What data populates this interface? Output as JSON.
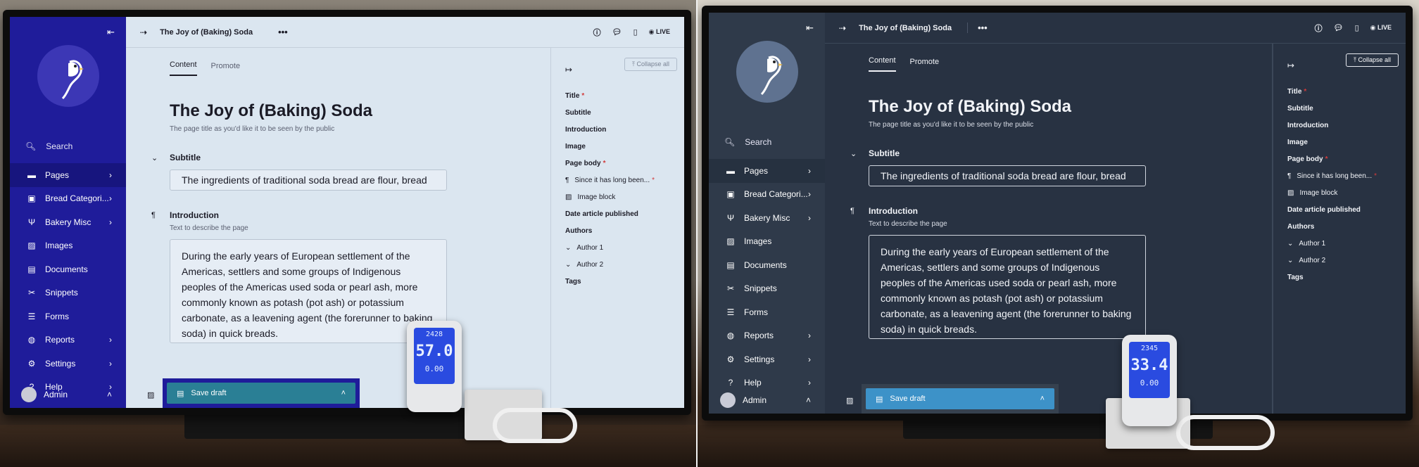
{
  "panels": [
    {
      "theme": "light",
      "topbar": {
        "title": "The Joy of (Baking) Soda",
        "live": "LIVE"
      },
      "meter": {
        "top": "2428",
        "mid": "57.0",
        "bot": "0.00"
      }
    },
    {
      "theme": "dark",
      "topbar": {
        "title": "The Joy of (Baking) Soda",
        "live": "LIVE"
      },
      "meter": {
        "top": "2345",
        "mid": "33.4",
        "bot": "0.00"
      }
    }
  ],
  "sidebar": {
    "search": "Search",
    "items": [
      {
        "label": "Pages",
        "icon": "folder-icon",
        "chevron": true
      },
      {
        "label": "Bread Categori...",
        "icon": "suitcase-icon",
        "chevron": true
      },
      {
        "label": "Bakery Misc",
        "icon": "utensils-icon",
        "chevron": true
      },
      {
        "label": "Images",
        "icon": "image-icon",
        "chevron": false
      },
      {
        "label": "Documents",
        "icon": "document-icon",
        "chevron": false
      },
      {
        "label": "Snippets",
        "icon": "snippet-icon",
        "chevron": false
      },
      {
        "label": "Forms",
        "icon": "form-icon",
        "chevron": false
      },
      {
        "label": "Reports",
        "icon": "globe-icon",
        "chevron": true
      },
      {
        "label": "Settings",
        "icon": "cogs-icon",
        "chevron": true
      },
      {
        "label": "Help",
        "icon": "help-icon",
        "chevron": true
      }
    ],
    "account": "Admin"
  },
  "tabs": {
    "content": "Content",
    "promote": "Promote"
  },
  "editor": {
    "title": "The Joy of (Baking) Soda",
    "title_help": "The page title as you'd like it to be seen by the public",
    "subtitle_label": "Subtitle",
    "subtitle_value": "The ingredients of traditional soda bread are flour, bread",
    "intro_label": "Introduction",
    "intro_help": "Text to describe the page",
    "intro_value": "During the early years of European settlement of the Americas, settlers and some groups of Indigenous peoples of the Americas used soda or pearl ash, more commonly known as potash (pot ash) or potassium carbonate, as a leavening agent (the forerunner to baking soda) in quick breads.",
    "save": "Save draft"
  },
  "outline": {
    "collapse_all": "Collapse all",
    "title": "Title",
    "subtitle": "Subtitle",
    "introduction": "Introduction",
    "image": "Image",
    "page_body": "Page body",
    "body_item1": "Since it has long been...",
    "body_item2": "Image block",
    "date": "Date article published",
    "authors": "Authors",
    "author1": "Author 1",
    "author2": "Author 2",
    "tags": "Tags"
  },
  "colors": {
    "light_sidebar": "#1f1c9a",
    "light_main": "#dbe6f0",
    "dark_sidebar": "#2f3a4a",
    "dark_main": "#283242",
    "save_light": "#2a7f95",
    "save_dark": "#3d92c8",
    "required": "#d23b3b"
  }
}
